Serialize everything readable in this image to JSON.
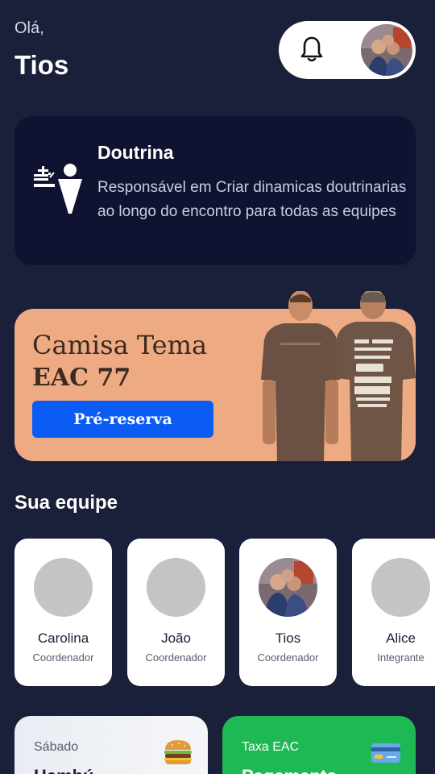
{
  "header": {
    "greeting": "Olá,",
    "username": "Tios"
  },
  "role_card": {
    "title": "Doutrina",
    "description": "Responsável em Criar dinamicas doutrinarias ao longo do encontro para todas as equipes"
  },
  "banner": {
    "title_line1": "Camisa Tema",
    "title_line2": "EAC 77",
    "button_label": "Pré-reserva"
  },
  "team": {
    "title": "Sua equipe",
    "members": [
      {
        "name": "Carolina",
        "role": "Coordenador",
        "has_photo": false
      },
      {
        "name": "João",
        "role": "Coordenador",
        "has_photo": false
      },
      {
        "name": "Tios",
        "role": "Coordenador",
        "has_photo": true
      },
      {
        "name": "Alice",
        "role": "Integrante",
        "has_photo": false
      }
    ]
  },
  "cards": {
    "saturday_label": "Sábado",
    "saturday_value": "Hambú...",
    "fee_label": "Taxa EAC",
    "fee_value": "Pagamento"
  },
  "icons": {
    "bell": "bell-icon",
    "role": "doctrine-icon",
    "saturday": "burger-icon",
    "fee": "credit-card-icon"
  },
  "colors": {
    "background": "#1a1f3a",
    "card_dark": "#0f1331",
    "banner": "#eeaa82",
    "button_blue": "#0b5bf5",
    "fee_green": "#1eb954"
  }
}
